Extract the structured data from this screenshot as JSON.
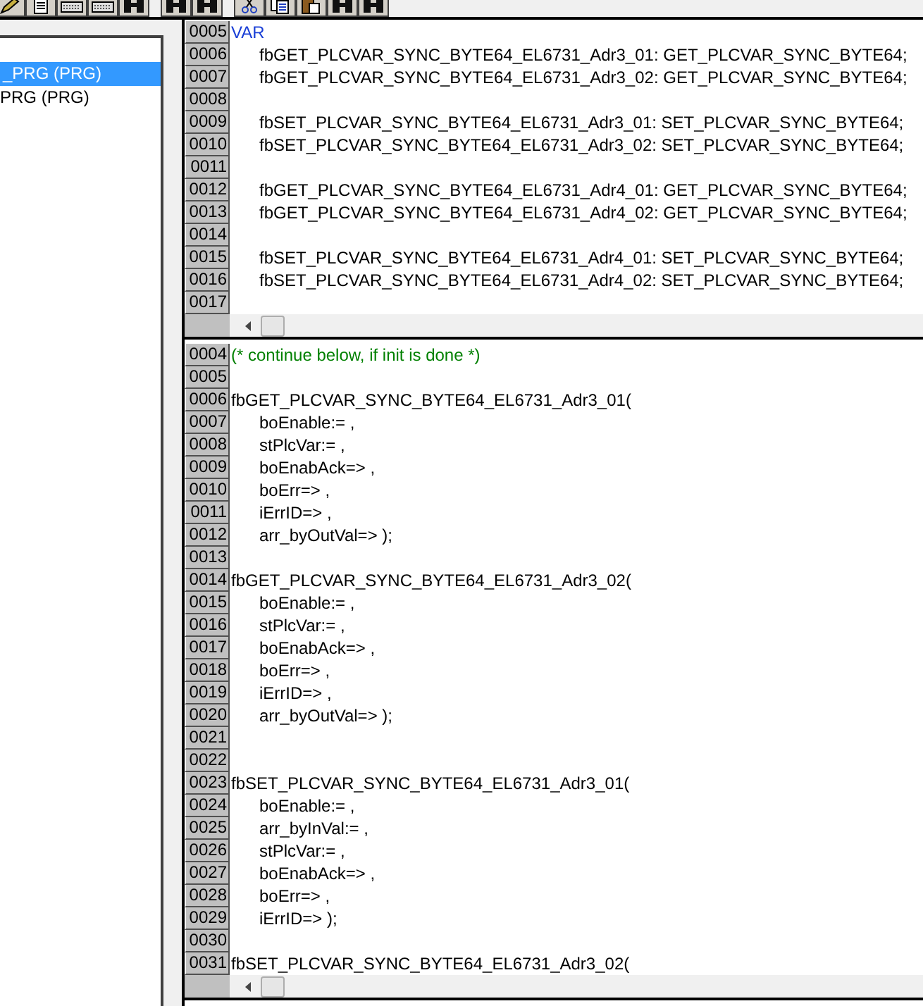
{
  "toolbar": {
    "groups": [
      {
        "buttons": [
          {
            "kind": "pencil"
          },
          {
            "kind": "document"
          },
          {
            "kind": "keyboard"
          },
          {
            "kind": "keyboard"
          },
          {
            "kind": "binoculars"
          }
        ]
      },
      {
        "buttons": [
          {
            "kind": "binoculars"
          },
          {
            "kind": "binoculars"
          }
        ]
      },
      {
        "buttons": [
          {
            "kind": "scissors"
          },
          {
            "kind": "copy"
          },
          {
            "kind": "paste"
          },
          {
            "kind": "binoculars"
          },
          {
            "kind": "binoculars"
          }
        ]
      }
    ]
  },
  "tree": {
    "items": [
      {
        "label": "_PRG (PRG)",
        "selected": true
      },
      {
        "label": "PRG (PRG)",
        "selected": false
      }
    ]
  },
  "declaration_editor": {
    "lines": [
      {
        "number": "0005",
        "text": "VAR",
        "kind": "keyword",
        "indent": false
      },
      {
        "number": "0006",
        "text": "fbGET_PLCVAR_SYNC_BYTE64_EL6731_Adr3_01: GET_PLCVAR_SYNC_BYTE64;",
        "kind": "code",
        "indent": true
      },
      {
        "number": "0007",
        "text": "fbGET_PLCVAR_SYNC_BYTE64_EL6731_Adr3_02: GET_PLCVAR_SYNC_BYTE64;",
        "kind": "code",
        "indent": true
      },
      {
        "number": "0008"
      },
      {
        "number": "0009",
        "text": "fbSET_PLCVAR_SYNC_BYTE64_EL6731_Adr3_01: SET_PLCVAR_SYNC_BYTE64;",
        "kind": "code",
        "indent": true
      },
      {
        "number": "0010",
        "text": "fbSET_PLCVAR_SYNC_BYTE64_EL6731_Adr3_02: SET_PLCVAR_SYNC_BYTE64;",
        "kind": "code",
        "indent": true
      },
      {
        "number": "0011"
      },
      {
        "number": "0012",
        "text": "fbGET_PLCVAR_SYNC_BYTE64_EL6731_Adr4_01: GET_PLCVAR_SYNC_BYTE64;",
        "kind": "code",
        "indent": true
      },
      {
        "number": "0013",
        "text": "fbGET_PLCVAR_SYNC_BYTE64_EL6731_Adr4_02: GET_PLCVAR_SYNC_BYTE64;",
        "kind": "code",
        "indent": true
      },
      {
        "number": "0014"
      },
      {
        "number": "0015",
        "text": "fbSET_PLCVAR_SYNC_BYTE64_EL6731_Adr4_01: SET_PLCVAR_SYNC_BYTE64;",
        "kind": "code",
        "indent": true
      },
      {
        "number": "0016",
        "text": "fbSET_PLCVAR_SYNC_BYTE64_EL6731_Adr4_02: SET_PLCVAR_SYNC_BYTE64;",
        "kind": "code",
        "indent": true
      },
      {
        "number": "0017"
      }
    ]
  },
  "body_editor": {
    "lines": [
      {
        "number": "0004",
        "text": "(* continue below, if init is done *)",
        "kind": "comment",
        "indent": false
      },
      {
        "number": "0005"
      },
      {
        "number": "0006",
        "text": "fbGET_PLCVAR_SYNC_BYTE64_EL6731_Adr3_01(",
        "kind": "code",
        "indent": false
      },
      {
        "number": "0007",
        "text": "boEnable:= ,",
        "kind": "code",
        "indent": true
      },
      {
        "number": "0008",
        "text": "stPlcVar:= ,",
        "kind": "code",
        "indent": true
      },
      {
        "number": "0009",
        "text": "boEnabAck=> ,",
        "kind": "code",
        "indent": true
      },
      {
        "number": "0010",
        "text": "boErr=> ,",
        "kind": "code",
        "indent": true
      },
      {
        "number": "0011",
        "text": "iErrID=> ,",
        "kind": "code",
        "indent": true
      },
      {
        "number": "0012",
        "text": "arr_byOutVal=> );",
        "kind": "code",
        "indent": true
      },
      {
        "number": "0013"
      },
      {
        "number": "0014",
        "text": "fbGET_PLCVAR_SYNC_BYTE64_EL6731_Adr3_02(",
        "kind": "code",
        "indent": false
      },
      {
        "number": "0015",
        "text": "boEnable:= ,",
        "kind": "code",
        "indent": true
      },
      {
        "number": "0016",
        "text": "stPlcVar:= ,",
        "kind": "code",
        "indent": true
      },
      {
        "number": "0017",
        "text": "boEnabAck=> ,",
        "kind": "code",
        "indent": true
      },
      {
        "number": "0018",
        "text": "boErr=> ,",
        "kind": "code",
        "indent": true
      },
      {
        "number": "0019",
        "text": "iErrID=> ,",
        "kind": "code",
        "indent": true
      },
      {
        "number": "0020",
        "text": "arr_byOutVal=> );",
        "kind": "code",
        "indent": true
      },
      {
        "number": "0021"
      },
      {
        "number": "0022"
      },
      {
        "number": "0023",
        "text": "fbSET_PLCVAR_SYNC_BYTE64_EL6731_Adr3_01(",
        "kind": "code",
        "indent": false
      },
      {
        "number": "0024",
        "text": "boEnable:= ,",
        "kind": "code",
        "indent": true
      },
      {
        "number": "0025",
        "text": "arr_byInVal:= ,",
        "kind": "code",
        "indent": true
      },
      {
        "number": "0026",
        "text": "stPlcVar:= ,",
        "kind": "code",
        "indent": true
      },
      {
        "number": "0027",
        "text": "boEnabAck=> ,",
        "kind": "code",
        "indent": true
      },
      {
        "number": "0028",
        "text": "boErr=> ,",
        "kind": "code",
        "indent": true
      },
      {
        "number": "0029",
        "text": "iErrID=> );",
        "kind": "code",
        "indent": true
      },
      {
        "number": "0030"
      },
      {
        "number": "0031",
        "text": "fbSET_PLCVAR_SYNC_BYTE64_EL6731_Adr3_02(",
        "kind": "code",
        "indent": false
      }
    ]
  }
}
